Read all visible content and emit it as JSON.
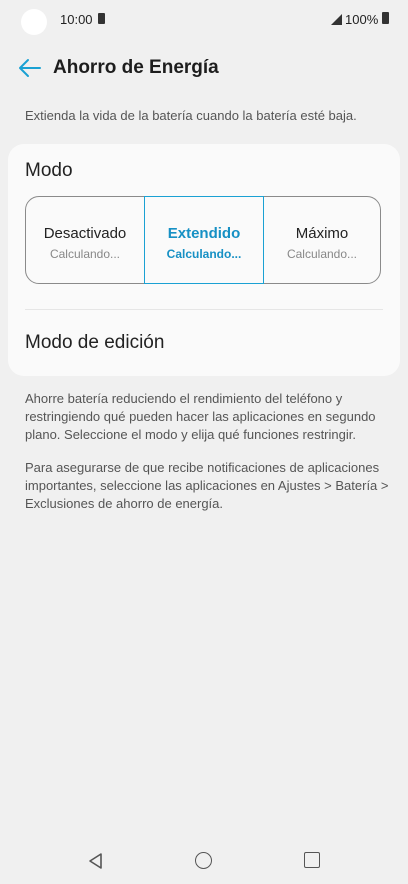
{
  "status": {
    "time": "10:00",
    "battery": "100%"
  },
  "header": {
    "title": "Ahorro de Energía"
  },
  "intro": "Extienda la vida de la batería cuando la batería esté baja.",
  "mode": {
    "heading": "Modo",
    "options": [
      {
        "label": "Desactivado",
        "sub": "Calculando...",
        "selected": false
      },
      {
        "label": "Extendido",
        "sub": "Calculando...",
        "selected": true
      },
      {
        "label": "Máximo",
        "sub": "Calculando...",
        "selected": false
      }
    ]
  },
  "edit_mode": "Modo de edición",
  "description": [
    "Ahorre batería reduciendo el rendimiento del teléfono y restringiendo qué pueden hacer las aplicaciones en segundo plano. Seleccione el modo y elija qué funciones restringir.",
    "Para asegurarse de que recibe notificaciones de aplicaciones importantes, seleccione las aplicaciones en Ajustes > Batería > Exclusiones de ahorro de energía."
  ],
  "colors": {
    "accent": "#1690c4",
    "background": "#f0f0f0",
    "card": "#fafafa"
  }
}
